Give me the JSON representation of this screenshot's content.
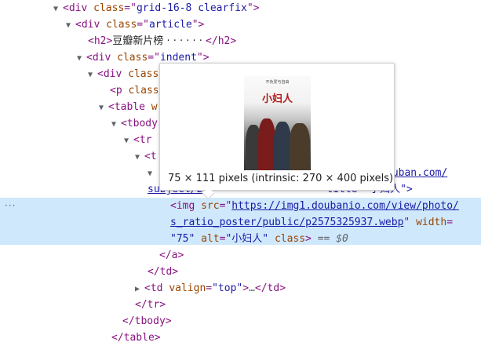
{
  "dom": {
    "l1": {
      "tag": "div",
      "attr": "class",
      "value": "grid-16-8 clearfix"
    },
    "l2": {
      "tag": "div",
      "attr": "class",
      "value": "article"
    },
    "l3": {
      "tag": "h2",
      "text": "豆瓣新片榜  · · · · · · ",
      "close": "</h2>"
    },
    "l4": {
      "tag": "div",
      "attr": "class",
      "value": "indent"
    },
    "l5": {
      "tag": "div",
      "attr": "class"
    },
    "l6": {
      "tag": "p",
      "attr": "class"
    },
    "l7": {
      "tag": "table",
      "attr": "w"
    },
    "l8": {
      "tag": "tbody"
    },
    "l9": {
      "tag": "tr"
    },
    "l10": {
      "tag": "t"
    },
    "l11_tail": "ouban.com/",
    "l12": {
      "link": "subject/27",
      "mid": "title=\"小妇人\">"
    },
    "img": {
      "tag": "img",
      "src_attr": "src",
      "src_line1": "https://img1.doubanio.com/view/photo/",
      "src_line2": "s_ratio_poster/public/p2575325937.webp",
      "width_attr": "width",
      "width_val": "\"75\"",
      "alt_attr": "alt",
      "alt_val": "\"小妇人\"",
      "class_attr": "class",
      "eq": "== $0"
    },
    "close_a": "</a>",
    "close_td": "</td>",
    "td2": {
      "tag": "td",
      "attr": "valign",
      "value": "\"top\"",
      "ellipsis": "…",
      "close": "</td>"
    },
    "close_tr": "</tr>",
    "close_tbody": "</tbody>",
    "close_table": "</table>"
  },
  "gutter_dots": "···",
  "tooltip": {
    "label": "75 × 111 pixels (intrinsic: 270 × 400 pixels)",
    "poster_title": "小妇人",
    "poster_top": "不负爱与自由"
  }
}
